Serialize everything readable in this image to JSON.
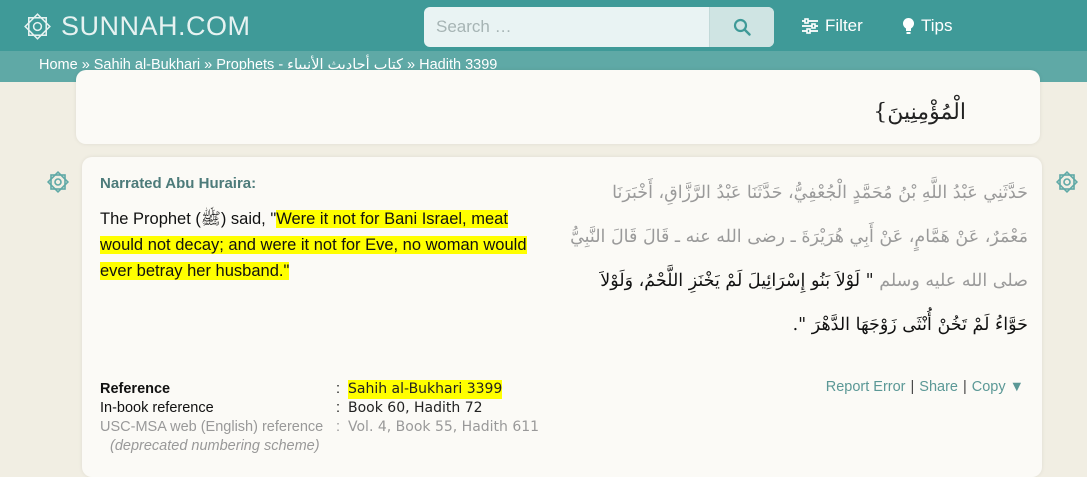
{
  "brand": {
    "name": "SUNNAH.COM",
    "accent": "#3f9a98"
  },
  "search": {
    "placeholder": "Search …",
    "icon": "search-icon"
  },
  "nav": {
    "filter_label": "Filter",
    "tips_label": "Tips"
  },
  "breadcrumb": {
    "items": [
      "Home",
      "Sahih al-Bukhari",
      "Prophets - كتاب أحاديث الأنبياء",
      "Hadith 3399"
    ],
    "separator": "»"
  },
  "previous_hadith": {
    "arabic_tail": "الْمُؤْمِنِينَ}"
  },
  "hadith": {
    "narrator": "Narrated Abu Huraira:",
    "text_prefix": "The Prophet (ﷺ) said, \"",
    "text_highlight_1": "Were it not for Bani Israel, meat",
    "text_highlight_2": "would not decay; and were it not for Eve, no woman would",
    "text_highlight_3": "ever betray her husband.\"",
    "arabic_grey": "حَدَّثَنِي عَبْدُ اللَّهِ بْنُ مُحَمَّدٍ الْجُعْفِيُّ، حَدَّثَنَا عَبْدُ الرَّزَّاقِ، أَخْبَرَنَا مَعْمَرٌ، عَنْ هَمَّامٍ، عَنْ أَبِي هُرَيْرَةَ ـ رضى الله عنه ـ قَالَ قَالَ النَّبِيُّ صلى الله عليه وسلم ",
    "arabic_dark": "\" لَوْلاَ بَنُو إِسْرَائِيلَ لَمْ يَخْنَزِ اللَّحْمُ، وَلَوْلاَ حَوَّاءُ لَمْ تَخُنْ أُنْثَى زَوْجَهَا الدَّهْرَ \".",
    "references": [
      {
        "label": "Reference",
        "value": "Sahih al-Bukhari 3399"
      },
      {
        "label": "In-book reference",
        "value": "Book 60, Hadith 72"
      },
      {
        "label": "USC-MSA web (English) reference",
        "value": "Vol. 4, Book 55, Hadith 611"
      }
    ],
    "deprecated_note": "(deprecated numbering scheme)",
    "actions": {
      "report": "Report Error",
      "share": "Share",
      "copy": "Copy ▼"
    },
    "highlight_color": "#ffff00"
  }
}
